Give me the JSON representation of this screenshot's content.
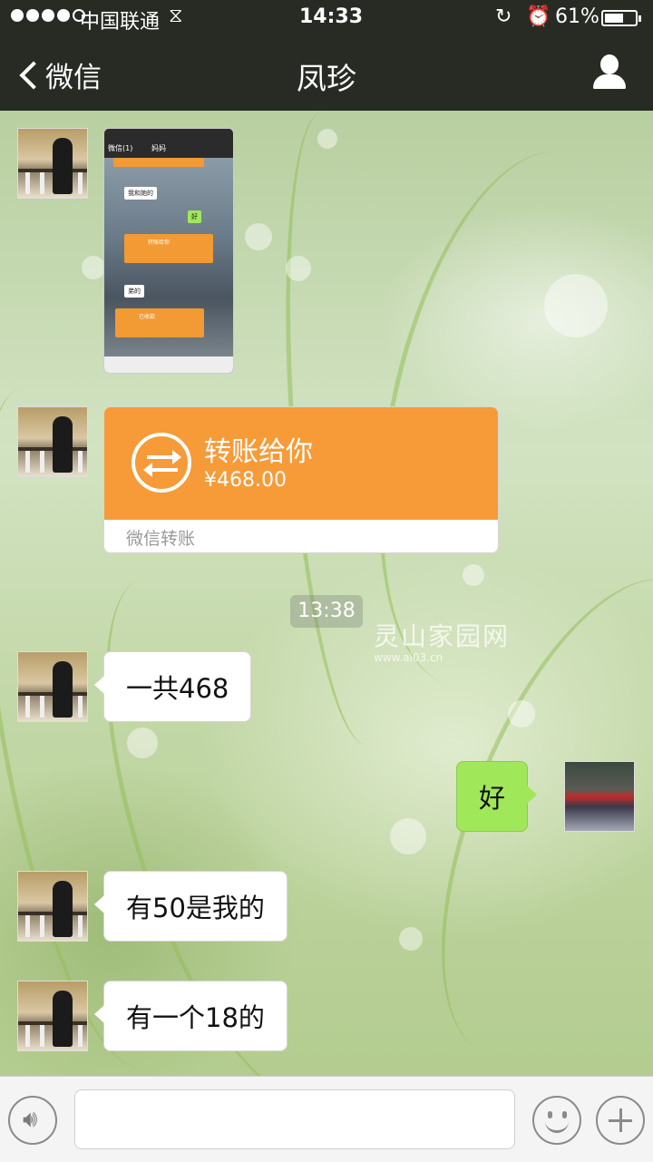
{
  "status_bar": {
    "carrier": "中国联通",
    "time": "14:33",
    "battery": "61%",
    "battery_level": 0.61,
    "signal_bars": 4,
    "icons": [
      "signal-icon",
      "wifi-icon",
      "rotation-lock-icon",
      "alarm-icon",
      "battery-icon"
    ]
  },
  "nav": {
    "back_label": "微信",
    "title": "凤珍",
    "icons": [
      "back-chevron-icon",
      "profile-icon"
    ]
  },
  "messages": [
    {
      "side": "left",
      "type": "image",
      "content": "screenshot of a chat",
      "image_text": {
        "top_back": "微信(1)",
        "top_title": "妈妈",
        "bubble_1": "我和她的",
        "bubble_2": "好",
        "bubble_3": "弟的",
        "card_1": "转账给你",
        "card_2": "已收款"
      }
    },
    {
      "side": "left",
      "type": "transfer",
      "title": "转账给你",
      "amount": "¥468.00",
      "footer": "微信转账"
    },
    {
      "type": "time",
      "text": "13:38"
    },
    {
      "side": "left",
      "type": "text",
      "text": "一共468"
    },
    {
      "side": "right",
      "type": "text",
      "text": "好"
    },
    {
      "side": "left",
      "type": "text",
      "text": "有50是我的"
    },
    {
      "side": "left",
      "type": "text",
      "text": "有一个18的"
    }
  ],
  "watermark": {
    "line1": "灵山家园网",
    "line2": "www.ai03.cn"
  },
  "input_bar": {
    "icons": [
      "voice-icon",
      "emoji-icon",
      "plus-icon"
    ],
    "placeholder": ""
  },
  "colors": {
    "bar_bg": "#272b24",
    "transfer_orange": "#f69b38",
    "sent_bubble": "#a0e75a"
  }
}
